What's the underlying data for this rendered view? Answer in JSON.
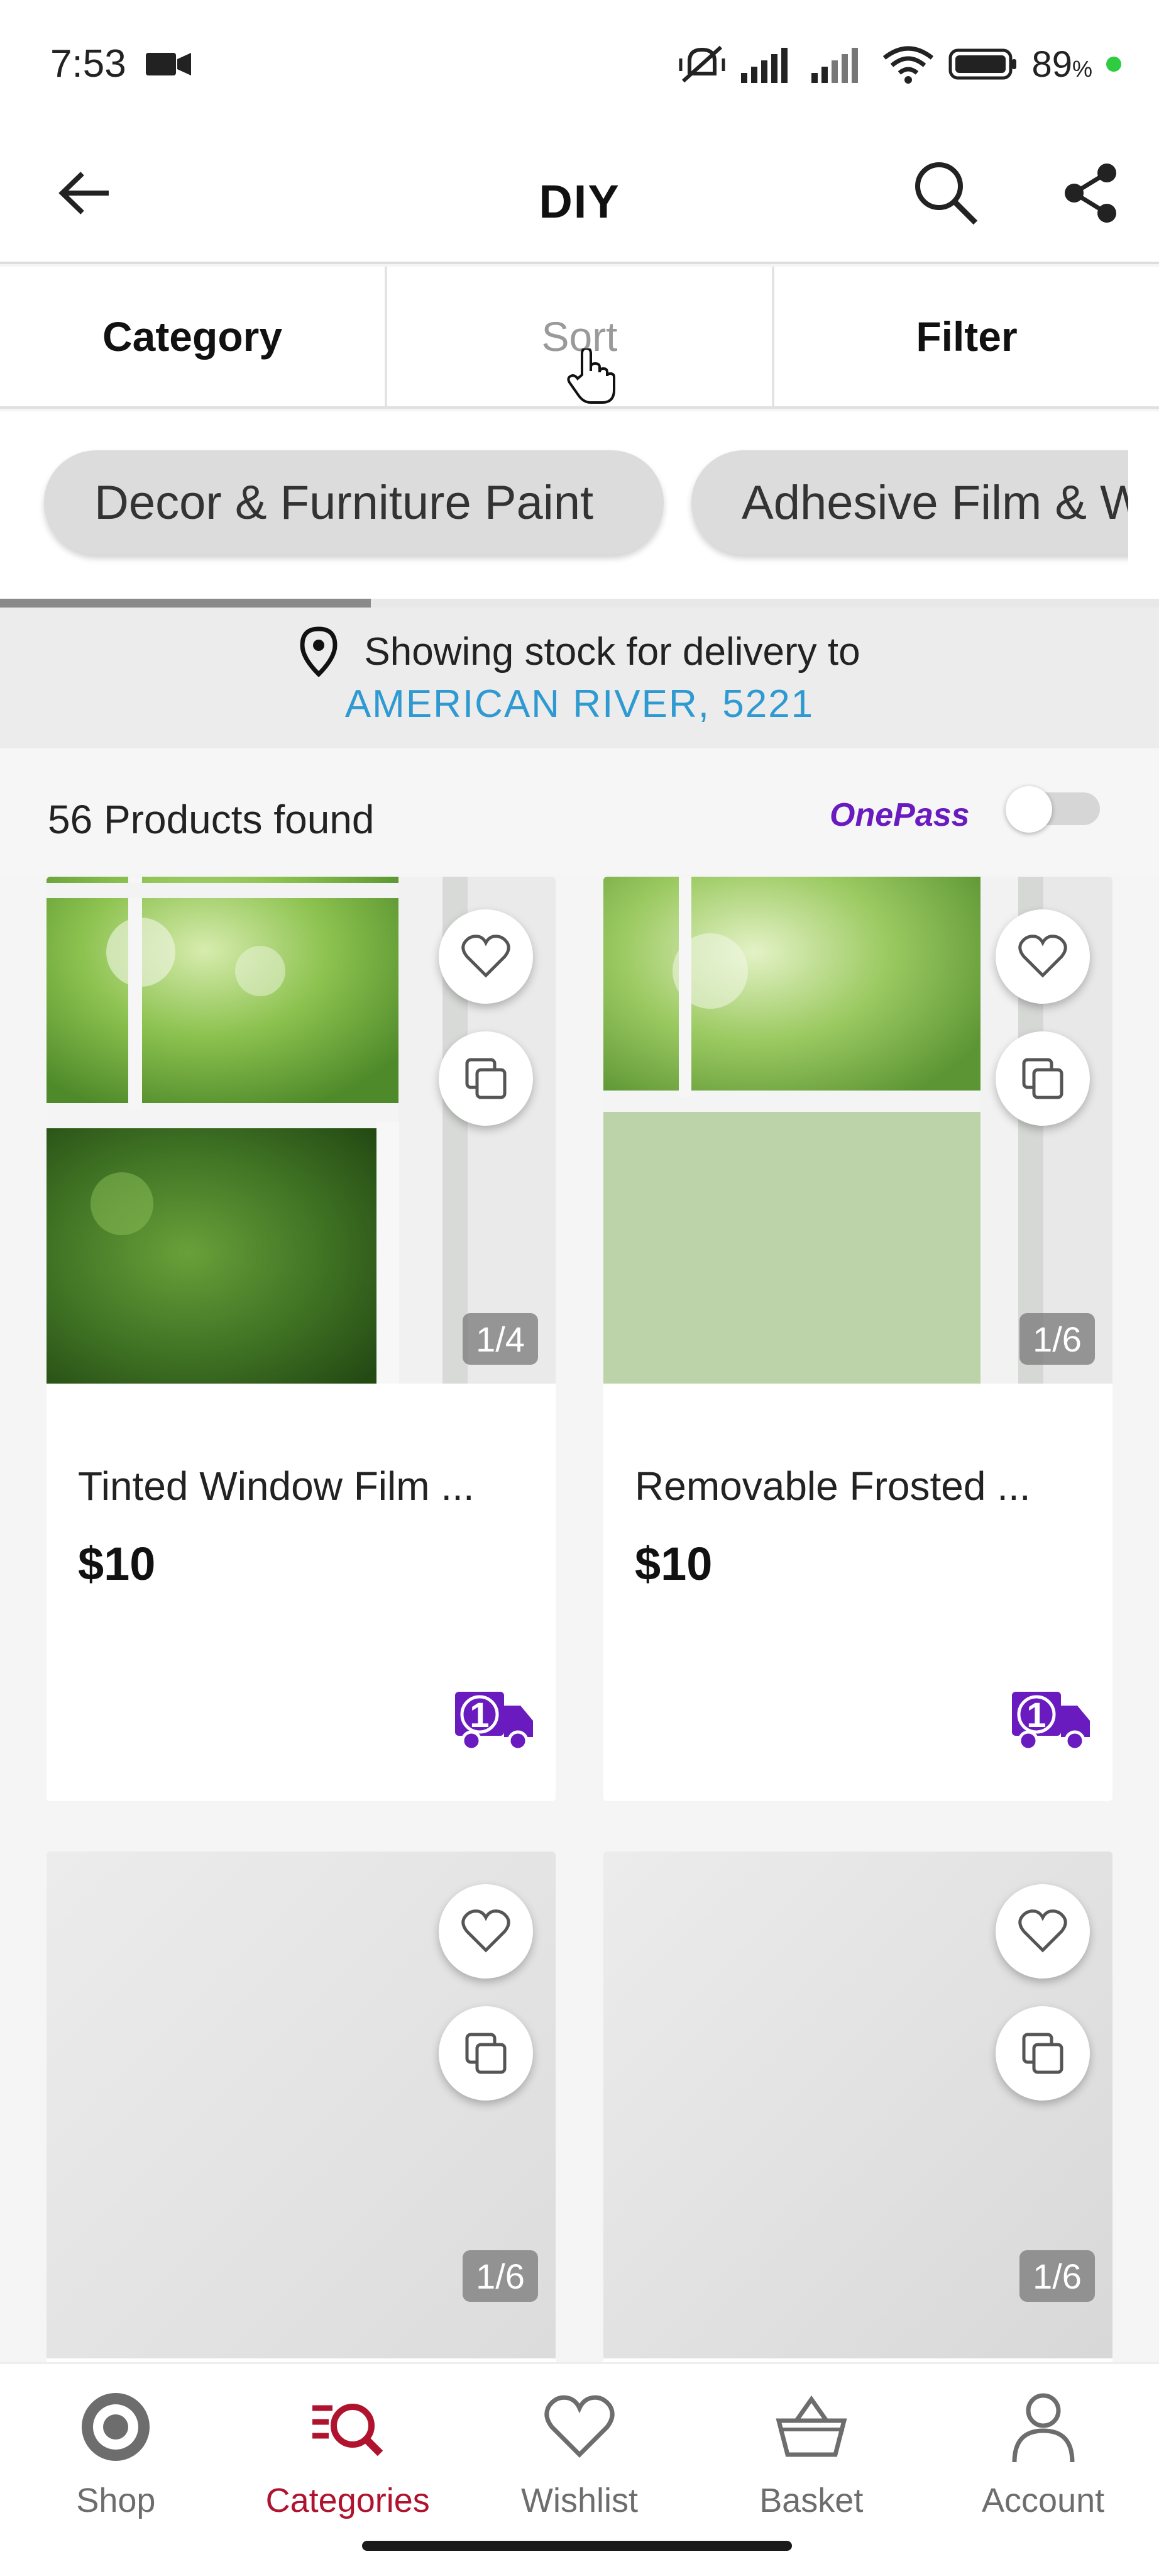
{
  "status_bar": {
    "time": "7:53",
    "battery": "89",
    "battery_unit": "%"
  },
  "header": {
    "title": "DIY"
  },
  "tabs": [
    {
      "label": "Category",
      "active": false
    },
    {
      "label": "Sort",
      "active": true
    },
    {
      "label": "Filter",
      "active": false
    }
  ],
  "chips": [
    "Decor & Furniture Paint",
    "Adhesive Film & Wallpaper"
  ],
  "delivery": {
    "prefix": "Showing stock for delivery to",
    "location": "AMERICAN RIVER, 5221"
  },
  "results": {
    "count_text": "56 Products found",
    "onepass_label": "OnePass",
    "onepass_toggle_on": false
  },
  "products": [
    {
      "name": "Tinted Window Film ...",
      "price": "$10",
      "image_counter": "1/4"
    },
    {
      "name": "Removable Frosted ...",
      "price": "$10",
      "image_counter": "1/6"
    },
    {
      "name": "",
      "price": "",
      "image_counter": "1/6"
    },
    {
      "name": "",
      "price": "",
      "image_counter": "1/6"
    }
  ],
  "bottom_nav": [
    {
      "label": "Shop",
      "icon": "target-icon"
    },
    {
      "label": "Categories",
      "icon": "categories-search-icon",
      "active": true
    },
    {
      "label": "Wishlist",
      "icon": "heart-icon"
    },
    {
      "label": "Basket",
      "icon": "basket-icon"
    },
    {
      "label": "Account",
      "icon": "person-icon"
    }
  ],
  "colors": {
    "accent": "#b0132e",
    "onepass": "#6a1bbf",
    "link": "#2f9ad1"
  }
}
